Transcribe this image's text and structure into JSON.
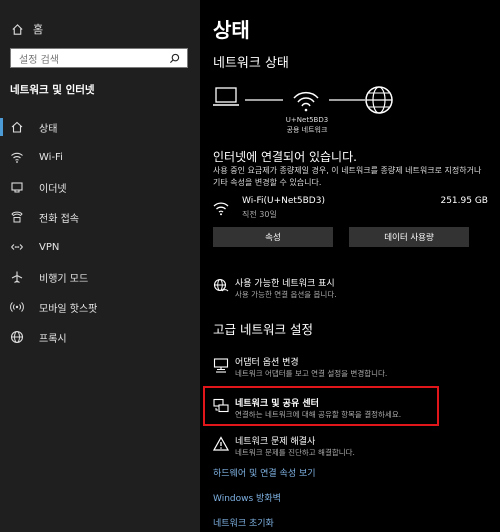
{
  "sidebar": {
    "home_label": "홈",
    "search_placeholder": "설정 검색",
    "section_title": "네트워크 및 인터넷",
    "items": [
      {
        "label": "상태",
        "icon": "home-network-icon"
      },
      {
        "label": "Wi-Fi",
        "icon": "wifi-icon"
      },
      {
        "label": "이더넷",
        "icon": "ethernet-icon"
      },
      {
        "label": "전화 접속",
        "icon": "dialup-icon"
      },
      {
        "label": "VPN",
        "icon": "vpn-icon"
      },
      {
        "label": "비행기 모드",
        "icon": "airplane-icon"
      },
      {
        "label": "모바일 핫스팟",
        "icon": "hotspot-icon"
      },
      {
        "label": "프록시",
        "icon": "globe-icon"
      }
    ]
  },
  "main": {
    "title": "상태",
    "network_status_title": "네트워크 상태",
    "diagram": {
      "network_name": "U+Net5BD3",
      "network_type": "공용 네트워크"
    },
    "connected_text": "인터넷에 연결되어 있습니다.",
    "description": "사용 중인 요금제가 종량제일 경우, 이 네트워크를 종량제 네트워크로 지정하거나 기타 속성을 변경할 수 있습니다.",
    "connection": {
      "name": "Wi-Fi(U+Net5BD3)",
      "period": "직전 30일",
      "usage": "251.95 GB"
    },
    "buttons": {
      "properties": "속성",
      "data_usage": "데이터 사용량"
    },
    "available_networks": {
      "title": "사용 가능한 네트워크 표시",
      "subtitle": "사용 가능한 연결 옵션을 봅니다."
    },
    "advanced_title": "고급 네트워크 설정",
    "adapter_options": {
      "title": "어댑터 옵션 변경",
      "subtitle": "네트워크 어댑터를 보고 연결 설정을 변경합니다."
    },
    "sharing_center": {
      "title": "네트워크 및 공유 센터",
      "subtitle": "연결하는 네트워크에 대해 공유할 항목을 결정하세요."
    },
    "troubleshooter": {
      "title": "네트워크 문제 해결사",
      "subtitle": "네트워크 문제를 진단하고 해결합니다."
    },
    "links": {
      "hardware": "하드웨어 및 연결 속성 보기",
      "firewall": "Windows 방화벽",
      "reset": "네트워크 초기화"
    }
  },
  "colors": {
    "sidebar_bg": "#1f1f1f",
    "main_bg": "#000000",
    "accent": "#4c9bd6",
    "link": "#7fb2e3",
    "highlight": "#e0161b"
  }
}
